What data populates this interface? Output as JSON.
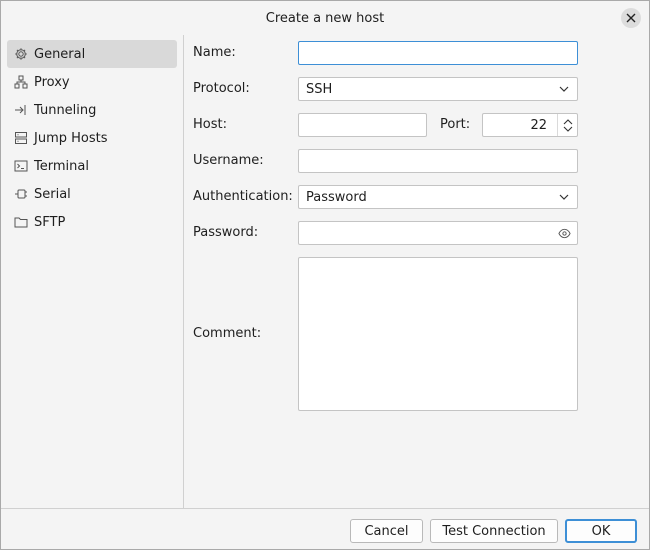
{
  "window": {
    "title": "Create a new host"
  },
  "sidebar": {
    "items": [
      {
        "label": "General",
        "icon": "gear-icon",
        "active": true
      },
      {
        "label": "Proxy",
        "icon": "proxy-icon"
      },
      {
        "label": "Tunneling",
        "icon": "tunnel-icon"
      },
      {
        "label": "Jump Hosts",
        "icon": "server-icon"
      },
      {
        "label": "Terminal",
        "icon": "terminal-icon"
      },
      {
        "label": "Serial",
        "icon": "plug-icon"
      },
      {
        "label": "SFTP",
        "icon": "folder-icon"
      }
    ]
  },
  "form": {
    "name_label": "Name:",
    "name_value": "",
    "protocol_label": "Protocol:",
    "protocol_value": "SSH",
    "host_label": "Host:",
    "host_value": "",
    "port_label": "Port:",
    "port_value": "22",
    "username_label": "Username:",
    "username_value": "",
    "auth_label": "Authentication:",
    "auth_value": "Password",
    "password_label": "Password:",
    "password_value": "",
    "comment_label": "Comment:",
    "comment_value": ""
  },
  "footer": {
    "cancel": "Cancel",
    "test": "Test Connection",
    "ok": "OK"
  },
  "colors": {
    "accent": "#3d8fd6",
    "selected": "#d9d9d9",
    "background": "#f4f4f4"
  }
}
